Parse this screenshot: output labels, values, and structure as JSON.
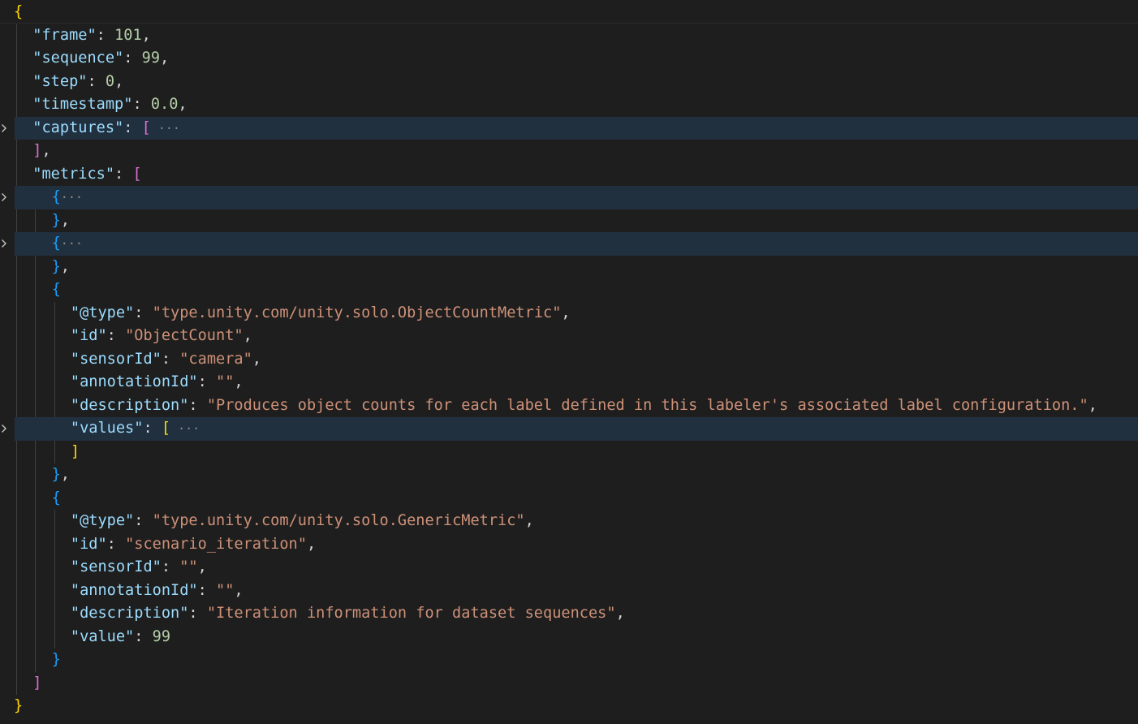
{
  "editor": {
    "fold_ellipsis": "···",
    "colors": {
      "background": "#1e1e1e",
      "key": "#9cdcfe",
      "string": "#ce9178",
      "number": "#b5cea8",
      "bracket_level_1": "#ffd700",
      "bracket_level_2": "#da70d6",
      "bracket_level_3": "#179fff",
      "folded_line_highlight": "#21303f"
    },
    "lines": [
      {
        "indent": 0,
        "tokens": [
          {
            "t": "{",
            "c": "b1"
          }
        ]
      },
      {
        "indent": 1,
        "tokens": [
          {
            "t": "\"frame\"",
            "c": "k"
          },
          {
            "t": ": ",
            "c": "p"
          },
          {
            "t": "101",
            "c": "n"
          },
          {
            "t": ",",
            "c": "p"
          }
        ]
      },
      {
        "indent": 1,
        "tokens": [
          {
            "t": "\"sequence\"",
            "c": "k"
          },
          {
            "t": ": ",
            "c": "p"
          },
          {
            "t": "99",
            "c": "n"
          },
          {
            "t": ",",
            "c": "p"
          }
        ]
      },
      {
        "indent": 1,
        "tokens": [
          {
            "t": "\"step\"",
            "c": "k"
          },
          {
            "t": ": ",
            "c": "p"
          },
          {
            "t": "0",
            "c": "n"
          },
          {
            "t": ",",
            "c": "p"
          }
        ]
      },
      {
        "indent": 1,
        "tokens": [
          {
            "t": "\"timestamp\"",
            "c": "k"
          },
          {
            "t": ": ",
            "c": "p"
          },
          {
            "t": "0.0",
            "c": "n"
          },
          {
            "t": ",",
            "c": "p"
          }
        ]
      },
      {
        "indent": 1,
        "folded": true,
        "tokens": [
          {
            "t": "\"captures\"",
            "c": "k"
          },
          {
            "t": ": ",
            "c": "p"
          },
          {
            "t": "[",
            "c": "b2"
          },
          {
            "t": " ···",
            "c": "ell"
          }
        ]
      },
      {
        "indent": 1,
        "tokens": [
          {
            "t": "]",
            "c": "b2"
          },
          {
            "t": ",",
            "c": "p"
          }
        ]
      },
      {
        "indent": 1,
        "tokens": [
          {
            "t": "\"metrics\"",
            "c": "k"
          },
          {
            "t": ": ",
            "c": "p"
          },
          {
            "t": "[",
            "c": "b2"
          }
        ]
      },
      {
        "indent": 2,
        "folded": true,
        "tokens": [
          {
            "t": "{",
            "c": "b3"
          },
          {
            "t": "···",
            "c": "ell"
          }
        ]
      },
      {
        "indent": 2,
        "tokens": [
          {
            "t": "}",
            "c": "b3"
          },
          {
            "t": ",",
            "c": "p"
          }
        ]
      },
      {
        "indent": 2,
        "folded": true,
        "tokens": [
          {
            "t": "{",
            "c": "b3"
          },
          {
            "t": "···",
            "c": "ell"
          }
        ]
      },
      {
        "indent": 2,
        "tokens": [
          {
            "t": "}",
            "c": "b3"
          },
          {
            "t": ",",
            "c": "p"
          }
        ]
      },
      {
        "indent": 2,
        "tokens": [
          {
            "t": "{",
            "c": "b3"
          }
        ]
      },
      {
        "indent": 3,
        "tokens": [
          {
            "t": "\"@type\"",
            "c": "k"
          },
          {
            "t": ": ",
            "c": "p"
          },
          {
            "t": "\"type.unity.com/unity.solo.ObjectCountMetric\"",
            "c": "s"
          },
          {
            "t": ",",
            "c": "p"
          }
        ]
      },
      {
        "indent": 3,
        "tokens": [
          {
            "t": "\"id\"",
            "c": "k"
          },
          {
            "t": ": ",
            "c": "p"
          },
          {
            "t": "\"ObjectCount\"",
            "c": "s"
          },
          {
            "t": ",",
            "c": "p"
          }
        ]
      },
      {
        "indent": 3,
        "tokens": [
          {
            "t": "\"sensorId\"",
            "c": "k"
          },
          {
            "t": ": ",
            "c": "p"
          },
          {
            "t": "\"camera\"",
            "c": "s"
          },
          {
            "t": ",",
            "c": "p"
          }
        ]
      },
      {
        "indent": 3,
        "tokens": [
          {
            "t": "\"annotationId\"",
            "c": "k"
          },
          {
            "t": ": ",
            "c": "p"
          },
          {
            "t": "\"\"",
            "c": "s"
          },
          {
            "t": ",",
            "c": "p"
          }
        ]
      },
      {
        "indent": 3,
        "tokens": [
          {
            "t": "\"description\"",
            "c": "k"
          },
          {
            "t": ": ",
            "c": "p"
          },
          {
            "t": "\"Produces object counts for each label defined in this labeler's associated label configuration.\"",
            "c": "s"
          },
          {
            "t": ",",
            "c": "p"
          }
        ]
      },
      {
        "indent": 3,
        "folded": true,
        "tokens": [
          {
            "t": "\"values\"",
            "c": "k"
          },
          {
            "t": ": ",
            "c": "p"
          },
          {
            "t": "[",
            "c": "b1"
          },
          {
            "t": " ···",
            "c": "ell"
          }
        ]
      },
      {
        "indent": 3,
        "tokens": [
          {
            "t": "]",
            "c": "b1"
          }
        ]
      },
      {
        "indent": 2,
        "tokens": [
          {
            "t": "}",
            "c": "b3"
          },
          {
            "t": ",",
            "c": "p"
          }
        ]
      },
      {
        "indent": 2,
        "tokens": [
          {
            "t": "{",
            "c": "b3"
          }
        ]
      },
      {
        "indent": 3,
        "tokens": [
          {
            "t": "\"@type\"",
            "c": "k"
          },
          {
            "t": ": ",
            "c": "p"
          },
          {
            "t": "\"type.unity.com/unity.solo.GenericMetric\"",
            "c": "s"
          },
          {
            "t": ",",
            "c": "p"
          }
        ]
      },
      {
        "indent": 3,
        "tokens": [
          {
            "t": "\"id\"",
            "c": "k"
          },
          {
            "t": ": ",
            "c": "p"
          },
          {
            "t": "\"scenario_iteration\"",
            "c": "s"
          },
          {
            "t": ",",
            "c": "p"
          }
        ]
      },
      {
        "indent": 3,
        "tokens": [
          {
            "t": "\"sensorId\"",
            "c": "k"
          },
          {
            "t": ": ",
            "c": "p"
          },
          {
            "t": "\"\"",
            "c": "s"
          },
          {
            "t": ",",
            "c": "p"
          }
        ]
      },
      {
        "indent": 3,
        "tokens": [
          {
            "t": "\"annotationId\"",
            "c": "k"
          },
          {
            "t": ": ",
            "c": "p"
          },
          {
            "t": "\"\"",
            "c": "s"
          },
          {
            "t": ",",
            "c": "p"
          }
        ]
      },
      {
        "indent": 3,
        "tokens": [
          {
            "t": "\"description\"",
            "c": "k"
          },
          {
            "t": ": ",
            "c": "p"
          },
          {
            "t": "\"Iteration information for dataset sequences\"",
            "c": "s"
          },
          {
            "t": ",",
            "c": "p"
          }
        ]
      },
      {
        "indent": 3,
        "tokens": [
          {
            "t": "\"value\"",
            "c": "k"
          },
          {
            "t": ": ",
            "c": "p"
          },
          {
            "t": "99",
            "c": "n"
          }
        ]
      },
      {
        "indent": 2,
        "tokens": [
          {
            "t": "}",
            "c": "b3"
          }
        ]
      },
      {
        "indent": 1,
        "tokens": [
          {
            "t": "]",
            "c": "b2"
          }
        ]
      },
      {
        "indent": 0,
        "tokens": [
          {
            "t": "}",
            "c": "b1"
          }
        ]
      }
    ]
  }
}
